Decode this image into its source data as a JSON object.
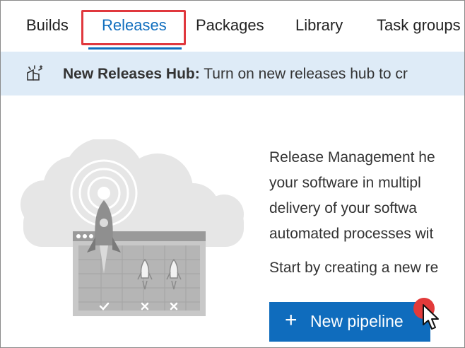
{
  "tabs": [
    {
      "label": "Builds",
      "selected": false
    },
    {
      "label": "Releases",
      "selected": true
    },
    {
      "label": "Packages",
      "selected": false
    },
    {
      "label": "Library",
      "selected": false
    },
    {
      "label": "Task groups",
      "selected": false
    }
  ],
  "banner": {
    "icon": "sparkle-icon",
    "title": "New Releases Hub:",
    "message": "Turn on new releases hub to cr"
  },
  "description": {
    "lines": [
      "Release Management he",
      "your software in multipl",
      "delivery of your softwa",
      "automated processes wit"
    ],
    "start_text": "Start by creating a new re"
  },
  "new_pipeline_button": {
    "label": "New pipeline",
    "icon": "plus-icon"
  },
  "colors": {
    "accent": "#0f6cbd",
    "banner_bg": "#deebf7",
    "highlight": "#e0383e"
  }
}
